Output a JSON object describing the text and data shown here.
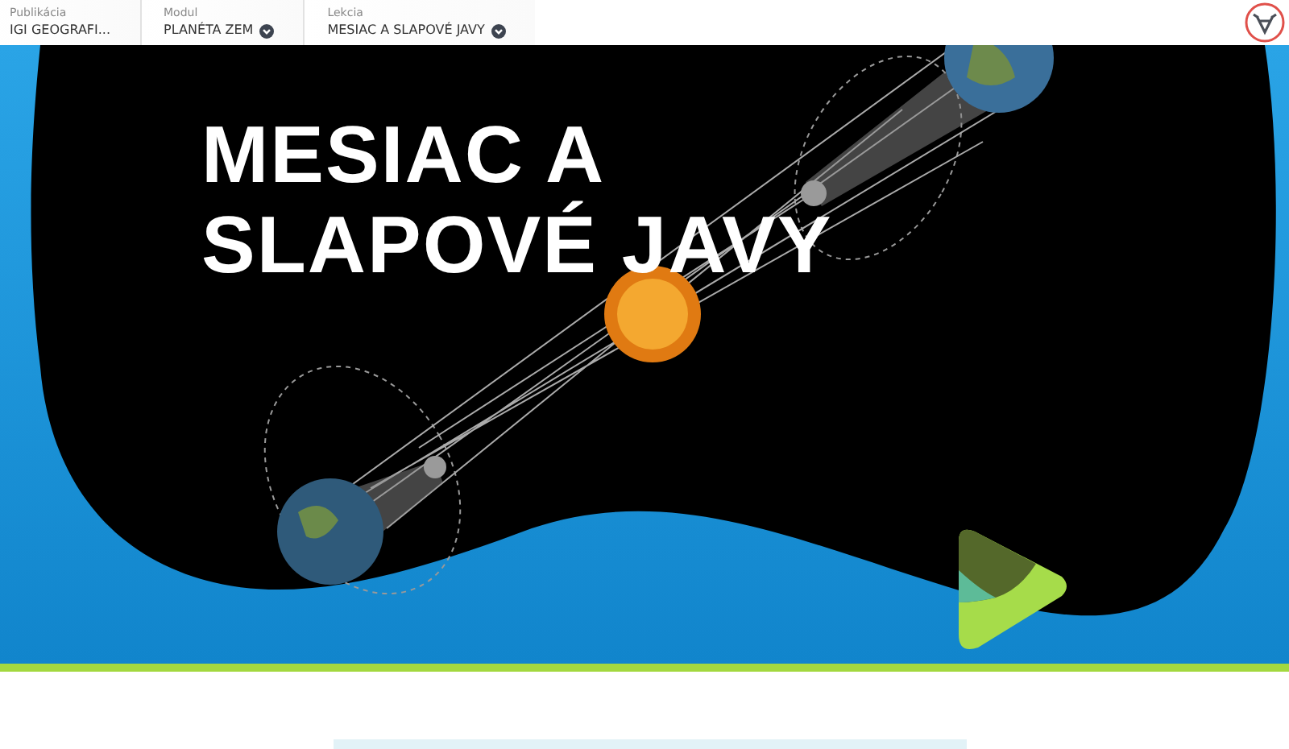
{
  "breadcrumbs": [
    {
      "label": "Publikácia",
      "value": "IGI GEOGRAFI...",
      "dropdown": false
    },
    {
      "label": "Modul",
      "value": "PLANÉTA ZEM",
      "dropdown": true
    },
    {
      "label": "Lekcia",
      "value": "MESIAC A SLAPOVÉ JAVY",
      "dropdown": true
    }
  ],
  "hero": {
    "title": "MESIAC A SLAPOVÉ JAVY"
  }
}
